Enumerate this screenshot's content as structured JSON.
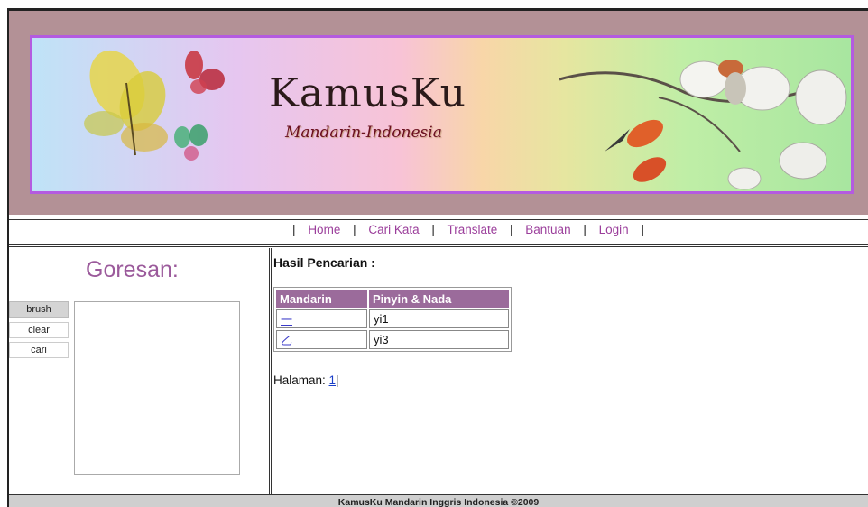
{
  "header": {
    "title": "KamusKu",
    "subtitle": "Mandarin-Indonesia"
  },
  "nav": {
    "items": [
      {
        "label": "Home"
      },
      {
        "label": "Cari Kata"
      },
      {
        "label": "Translate"
      },
      {
        "label": "Bantuan"
      },
      {
        "label": "Login"
      }
    ]
  },
  "sidebar": {
    "title": "Goresan:",
    "tools": {
      "brush": "brush",
      "clear": "clear",
      "search": "cari"
    }
  },
  "results": {
    "title": "Hasil Pencarian :",
    "columns": [
      "Mandarin",
      "Pinyin & Nada"
    ],
    "rows": [
      {
        "mandarin": "一",
        "pinyin": "yi1"
      },
      {
        "mandarin": "乙",
        "pinyin": "yi3"
      }
    ],
    "pager_label": "Halaman: ",
    "pager_page": "1",
    "pager_suffix": "|"
  },
  "footer": {
    "text": "KamusKu Mandarin Inggris Indonesia ©2009"
  },
  "colors": {
    "accent": "#9b6b9b",
    "link": "#9b3e9b",
    "banner_border": "#b45be0",
    "banner_frame": "#b39196"
  }
}
